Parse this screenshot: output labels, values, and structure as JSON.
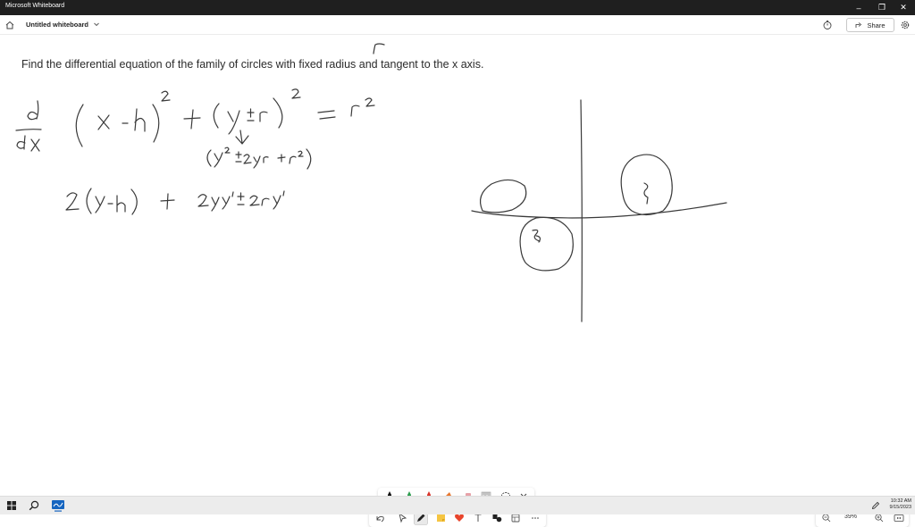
{
  "window": {
    "app_title": "Microsoft Whiteboard",
    "minimize_glyph": "–",
    "restore_glyph": "❐",
    "close_glyph": "✕"
  },
  "header": {
    "board_name": "Untitled whiteboard",
    "share_label": "Share"
  },
  "canvas": {
    "question_text": "Find the differential equation of the family of circles with fixed radius and tangent to the x axis."
  },
  "zoom": {
    "level": "39%"
  },
  "taskbar": {
    "time": "10:32 AM",
    "date": "9/15/2023"
  },
  "colors": {
    "titlebar": "#1f1f1f",
    "ink": "#3a3a3a",
    "pen_red": "#d9342b",
    "pen_green": "#2e9e4f",
    "pen_orange": "#e8772e",
    "pen_black": "#111111",
    "heart": "#e8452c"
  }
}
